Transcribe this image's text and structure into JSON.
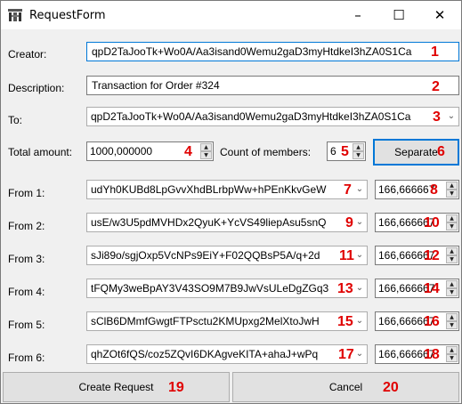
{
  "window": {
    "title": "RequestForm",
    "icon": "app-emblem-icon",
    "minimize": "–",
    "maximize": "☐",
    "close": "✕"
  },
  "creator": {
    "label": "Creator:",
    "value": "qpD2TaJooTk+Wo0A/Aa3isand0Wemu2gaD3myHtdkeI3hZA0S1Ca",
    "badge": "1"
  },
  "description": {
    "label": "Description:",
    "value": "Transaction for Order #324",
    "badge": "2"
  },
  "to": {
    "label": "To:",
    "value": "qpD2TaJooTk+Wo0A/Aa3isand0Wemu2gaD3myHtdkeI3hZA0S1Ca",
    "badge": "3"
  },
  "total": {
    "label": "Total amount:",
    "value": "1000,000000",
    "badge": "4"
  },
  "members": {
    "label": "Count of members:",
    "value": "6",
    "badge": "5"
  },
  "separate": {
    "label": "Separate",
    "badge": "6"
  },
  "from_rows": [
    {
      "label": "From 1:",
      "account": "udYh0KUBd8LpGvvXhdBLrbpWw+hPEnKkvGeW",
      "amount": "166,666667",
      "account_badge": "7",
      "amount_badge": "8"
    },
    {
      "label": "From 2:",
      "account": "usE/w3U5pdMVHDx2QyuK+YcVS49liepAsu5snQ",
      "amount": "166,666667",
      "account_badge": "9",
      "amount_badge": "10"
    },
    {
      "label": "From 3:",
      "account": "sJi89o/sgjOxp5VcNPs9EiY+F02QQBsP5A/q+2d",
      "amount": "166,666667",
      "account_badge": "11",
      "amount_badge": "12"
    },
    {
      "label": "From 4:",
      "account": "tFQMy3weBpAY3V43SO9M7B9JwVsULeDgZGq3",
      "amount": "166,666667",
      "account_badge": "13",
      "amount_badge": "14"
    },
    {
      "label": "From 5:",
      "account": "sClB6DMmfGwgtFTPsctu2KMUpxg2MelXtoJwH",
      "amount": "166,666667",
      "account_badge": "15",
      "amount_badge": "16"
    },
    {
      "label": "From 6:",
      "account": "qhZOt6fQS/coz5ZQvI6DKAgveKITA+ahaJ+wPq",
      "amount": "166,666667",
      "account_badge": "17",
      "amount_badge": "18"
    }
  ],
  "create": {
    "label": "Create Request",
    "badge": "19"
  },
  "cancel": {
    "label": "Cancel",
    "badge": "20"
  },
  "colors": {
    "badge": "#e00000",
    "focus": "#0078d7"
  }
}
